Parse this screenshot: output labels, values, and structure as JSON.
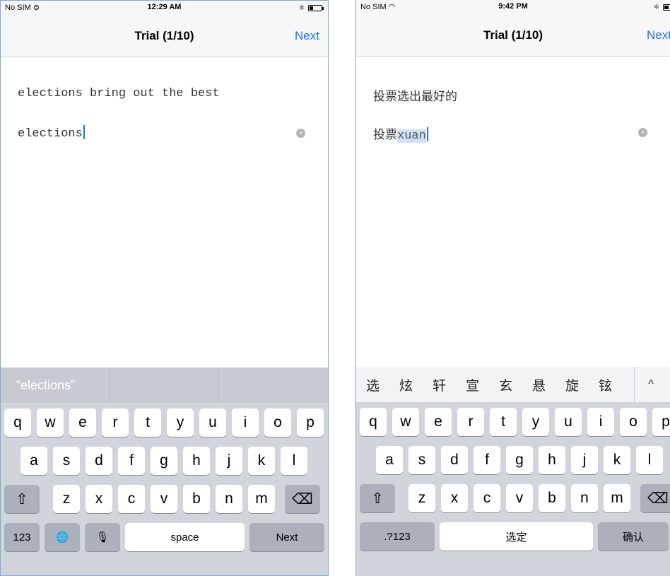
{
  "left": {
    "status": {
      "carrier": "No SIM",
      "time": "12:29 AM"
    },
    "nav": {
      "title": "Trial (1/10)",
      "next": "Next"
    },
    "prompt": "elections bring out the best",
    "input": {
      "typed": "elections"
    },
    "suggestions": [
      "“elections”",
      "",
      ""
    ],
    "keyboard": {
      "row1": [
        "q",
        "w",
        "e",
        "r",
        "t",
        "y",
        "u",
        "i",
        "o",
        "p"
      ],
      "row2": [
        "a",
        "s",
        "d",
        "f",
        "g",
        "h",
        "j",
        "k",
        "l"
      ],
      "row3": [
        "z",
        "x",
        "c",
        "v",
        "b",
        "n",
        "m"
      ],
      "numbers_key": "123",
      "space_key": "space",
      "return_key": "Next"
    }
  },
  "right": {
    "status": {
      "carrier": "No SIM",
      "time": "9:42 PM"
    },
    "nav": {
      "title": "Trial (1/10)",
      "next": "Next"
    },
    "prompt": "投票选出最好的",
    "input": {
      "committed": "投票",
      "composing": "xuan"
    },
    "candidates": [
      "选",
      "炫",
      "轩",
      "宣",
      "玄",
      "悬",
      "旋",
      "铉"
    ],
    "keyboard": {
      "row1": [
        "q",
        "w",
        "e",
        "r",
        "t",
        "y",
        "u",
        "i",
        "o",
        "p"
      ],
      "row2": [
        "a",
        "s",
        "d",
        "f",
        "g",
        "h",
        "j",
        "k",
        "l"
      ],
      "row3": [
        "z",
        "x",
        "c",
        "v",
        "b",
        "n",
        "m"
      ],
      "numbers_key": ".?123",
      "space_key": "选定",
      "return_key": "确认"
    }
  },
  "icons": {
    "shift": "⇧",
    "delete": "⌫",
    "globe": "🌐",
    "mic": "🎙",
    "bluetooth": "✱",
    "expand": "^",
    "clear": "×"
  }
}
